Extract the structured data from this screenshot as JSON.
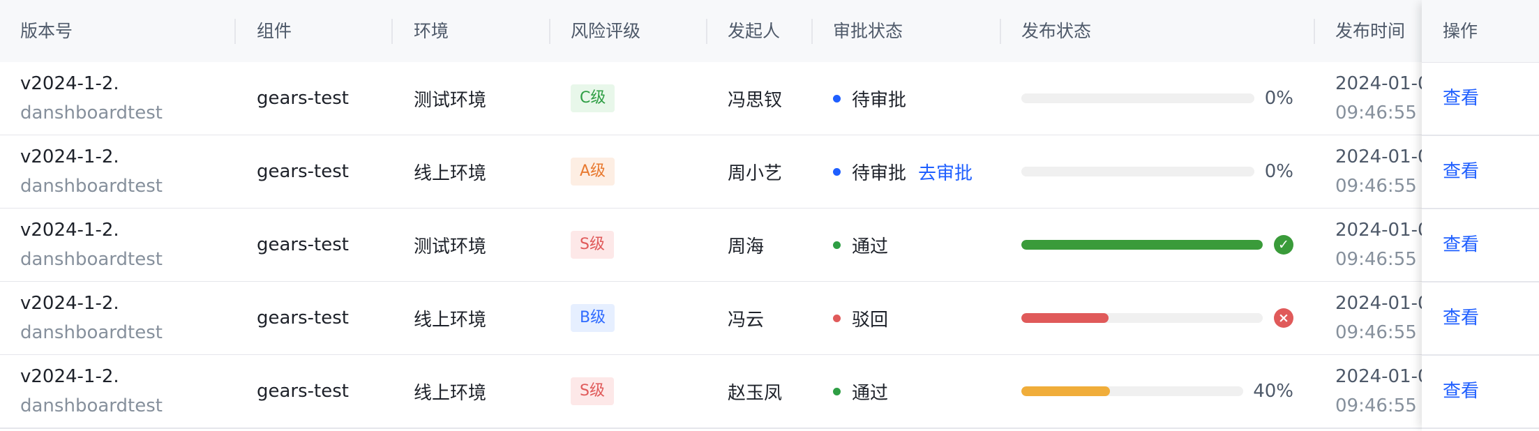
{
  "table": {
    "headers": {
      "version": "版本号",
      "component": "组件",
      "env": "环境",
      "risk": "风险评级",
      "initiator": "发起人",
      "approval": "审批状态",
      "release": "发布状态",
      "time": "发布时间",
      "action": "操作"
    },
    "rows": [
      {
        "version_line1": "v2024-1-2.",
        "version_line2": "danshboardtest",
        "component": "gears-test",
        "env": "测试环境",
        "risk": "C级",
        "initiator": "冯思钗",
        "approval_status": "待审批",
        "approval_action": "",
        "progress": 0,
        "progress_label": "0%",
        "result": "",
        "time_line1": "2024-01-0",
        "time_line2": "09:46:55",
        "action": "查看"
      },
      {
        "version_line1": "v2024-1-2.",
        "version_line2": "danshboardtest",
        "component": "gears-test",
        "env": "线上环境",
        "risk": "A级",
        "initiator": "周小艺",
        "approval_status": "待审批",
        "approval_action": "去审批",
        "progress": 0,
        "progress_label": "0%",
        "result": "",
        "time_line1": "2024-01-0",
        "time_line2": "09:46:55",
        "action": "查看"
      },
      {
        "version_line1": "v2024-1-2.",
        "version_line2": "danshboardtest",
        "component": "gears-test",
        "env": "测试环境",
        "risk": "S级",
        "initiator": "周海",
        "approval_status": "通过",
        "approval_action": "",
        "progress": 1,
        "progress_label": "",
        "result": "success",
        "time_line1": "2024-01-0",
        "time_line2": "09:46:55",
        "action": "查看"
      },
      {
        "version_line1": "v2024-1-2.",
        "version_line2": "danshboardtest",
        "component": "gears-test",
        "env": "线上环境",
        "risk": "B级",
        "initiator": "冯云",
        "approval_status": "驳回",
        "approval_action": "",
        "progress": 0.36,
        "progress_label": "",
        "result": "error",
        "time_line1": "2024-01-0",
        "time_line2": "09:46:55",
        "action": "查看"
      },
      {
        "version_line1": "v2024-1-2.",
        "version_line2": "danshboardtest",
        "component": "gears-test",
        "env": "线上环境",
        "risk": "S级",
        "initiator": "赵玉凤",
        "approval_status": "通过",
        "approval_action": "",
        "progress": 0.4,
        "progress_label": "40%",
        "result": "",
        "time_line1": "2024-01-0",
        "time_line2": "09:46:55",
        "action": "查看"
      }
    ]
  },
  "colors": {
    "link": "#1f5fff",
    "risk": {
      "C级": {
        "bg": "#e8f7ea",
        "fg": "#2e9e44"
      },
      "A级": {
        "bg": "#fdeee3",
        "fg": "#e8792f"
      },
      "S级": {
        "bg": "#fde8e8",
        "fg": "#e05a5a"
      },
      "B级": {
        "bg": "#e6efff",
        "fg": "#2f6bff"
      }
    },
    "approval_dot": {
      "待审批": "#1f5fff",
      "通过": "#2e9e44",
      "驳回": "#e05a5a"
    },
    "progress_fill": {
      "success": "#3a9b3a",
      "error": "#e05a5a",
      "normal": "#f0ad3a"
    },
    "result_icon": {
      "success": "#3a9b3a",
      "error": "#e05a5a"
    }
  },
  "icons": {
    "success": "check-circle-icon",
    "error": "close-circle-icon"
  }
}
